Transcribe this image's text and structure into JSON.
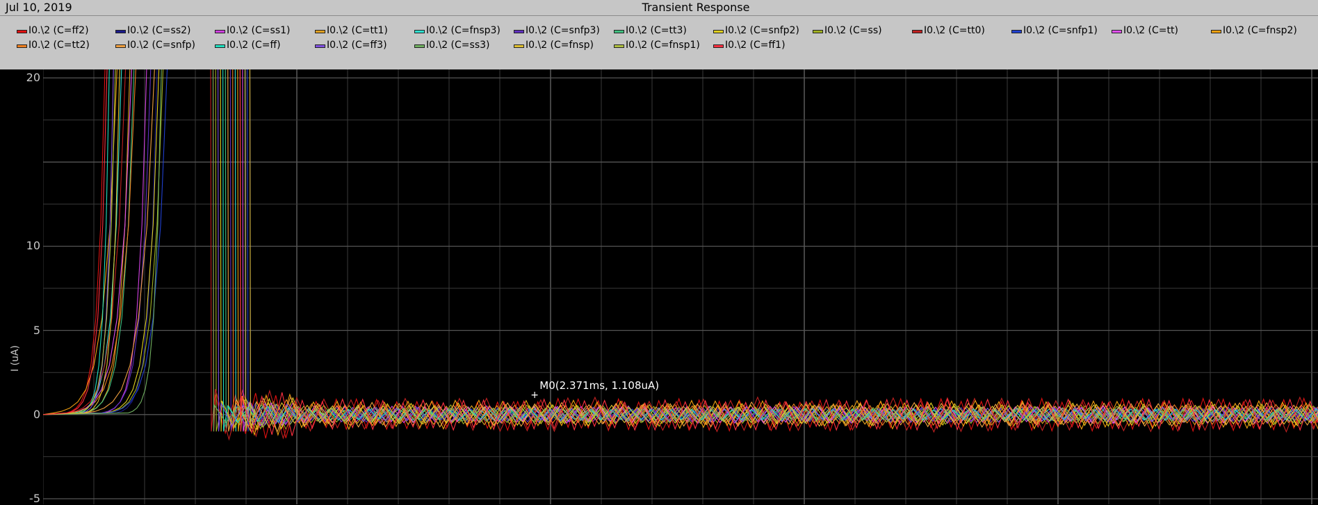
{
  "header": {
    "date": "Jul 10, 2019",
    "title": "Transient Response"
  },
  "colors": {
    "header_bg": "#c6c6c6",
    "plot_bg": "#000000",
    "grid": "#3a3a3a",
    "axis_text": "#c8c8c8"
  },
  "chart_data": {
    "type": "line",
    "title": "Transient Response",
    "xlabel": "",
    "ylabel": "I (uA)",
    "ylim": [
      -5,
      20.5
    ],
    "yticks": [
      20,
      10,
      5,
      0,
      -5
    ],
    "grid": true,
    "legend_position": "top",
    "series": [
      {
        "name": "I0.\\2  (C=ff2)",
        "color": "#e01010",
        "burst_ms": 0.3,
        "tail_amp": 0.85
      },
      {
        "name": "I0.\\2  (C=ss2)",
        "color": "#1a1a8a",
        "burst_ms": 0.55,
        "tail_amp": 0.35
      },
      {
        "name": "I0.\\2  (C=ss1)",
        "color": "#d040e0",
        "burst_ms": 0.5,
        "tail_amp": 0.45
      },
      {
        "name": "I0.\\2  (C=tt1)",
        "color": "#e0a020",
        "burst_ms": 0.42,
        "tail_amp": 0.55
      },
      {
        "name": "I0.\\2  (C=fnsp3)",
        "color": "#30e0d0",
        "burst_ms": 0.38,
        "tail_amp": 0.3
      },
      {
        "name": "I0.\\2  (C=snfp3)",
        "color": "#6030c0",
        "burst_ms": 0.52,
        "tail_amp": 0.4
      },
      {
        "name": "I0.\\2  (C=tt3)",
        "color": "#40c080",
        "burst_ms": 0.44,
        "tail_amp": 0.35
      },
      {
        "name": "I0.\\2  (C=snfp2)",
        "color": "#e0d020",
        "burst_ms": 0.56,
        "tail_amp": 0.6
      },
      {
        "name": "I0.\\2  (C=ss)",
        "color": "#a0b020",
        "burst_ms": 0.58,
        "tail_amp": 0.5
      },
      {
        "name": "I0.\\2  (C=tt0)",
        "color": "#c02020",
        "burst_ms": 0.4,
        "tail_amp": 0.9
      },
      {
        "name": "I0.\\2  (C=snfp1)",
        "color": "#2040d0",
        "burst_ms": 0.6,
        "tail_amp": 0.3
      },
      {
        "name": "I0.\\2  (C=tt)",
        "color": "#e050f0",
        "burst_ms": 0.43,
        "tail_amp": 0.45
      },
      {
        "name": "I0.\\2  (C=fnsp2)",
        "color": "#f0a010",
        "burst_ms": 0.36,
        "tail_amp": 0.75
      },
      {
        "name": "I0.\\2  (C=tt2)",
        "color": "#f08020",
        "burst_ms": 0.45,
        "tail_amp": 0.55
      },
      {
        "name": "I0.\\2  (C=snfp)",
        "color": "#f0a040",
        "burst_ms": 0.54,
        "tail_amp": 0.65
      },
      {
        "name": "I0.\\2  (C=ff)",
        "color": "#20e0c0",
        "burst_ms": 0.32,
        "tail_amp": 0.3
      },
      {
        "name": "I0.\\2  (C=ff3)",
        "color": "#8050e0",
        "burst_ms": 0.34,
        "tail_amp": 0.4
      },
      {
        "name": "I0.\\2  (C=ss3)",
        "color": "#70b060",
        "burst_ms": 0.57,
        "tail_amp": 0.35
      },
      {
        "name": "I0.\\2  (C=fnsp)",
        "color": "#e0c030",
        "burst_ms": 0.37,
        "tail_amp": 0.5
      },
      {
        "name": "I0.\\2  (C=fnsp1)",
        "color": "#b0c040",
        "burst_ms": 0.35,
        "tail_amp": 0.45
      },
      {
        "name": "I0.\\2  (C=ff1)",
        "color": "#ff3040",
        "burst_ms": 0.31,
        "tail_amp": 0.8
      }
    ],
    "marker": {
      "label": "M0(2.371ms, 1.108uA)",
      "x_ms": 2.371,
      "y_uA": 1.108
    }
  }
}
